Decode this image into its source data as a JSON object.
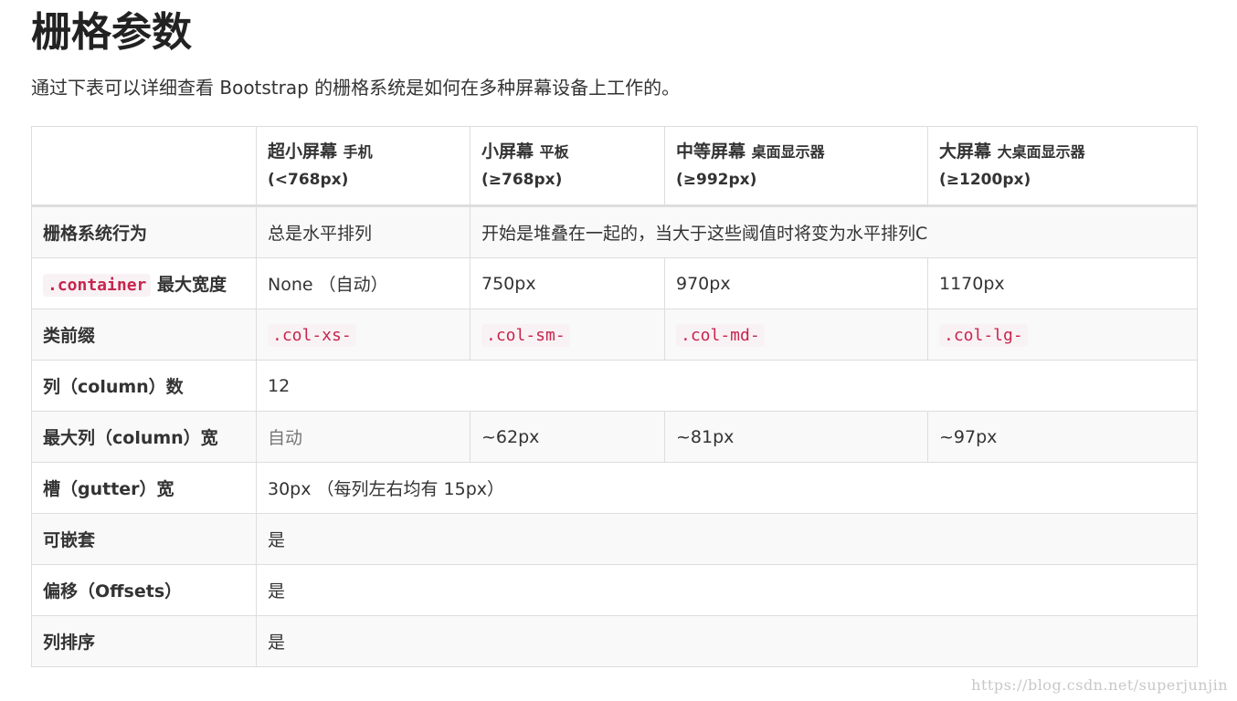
{
  "heading": "栅格参数",
  "intro": "通过下表可以详细查看 Bootstrap 的栅格系统是如何在多种屏幕设备上工作的。",
  "table": {
    "header": {
      "col1": {
        "main": "超小屏幕",
        "sub": "手机",
        "range": "(<768px)"
      },
      "col2": {
        "main": "小屏幕",
        "sub": "平板",
        "range": "(≥768px)"
      },
      "col3": {
        "main": "中等屏幕",
        "sub": "桌面显示器",
        "range": "(≥992px)"
      },
      "col4": {
        "main": "大屏幕",
        "sub": "大桌面显示器",
        "range": "(≥1200px)"
      }
    },
    "row_behavior": {
      "label": "栅格系统行为",
      "xs": "总是水平排列",
      "rest": "开始是堆叠在一起的，当大于这些阈值时将变为水平排列C"
    },
    "row_container": {
      "code": ".container",
      "label": "最大宽度",
      "xs": "None （自动）",
      "sm": "750px",
      "md": "970px",
      "lg": "1170px"
    },
    "row_prefix": {
      "label": "类前缀",
      "xs": ".col-xs-",
      "sm": ".col-sm-",
      "md": ".col-md-",
      "lg": ".col-lg-"
    },
    "row_columns": {
      "label": "列（column）数",
      "value": "12"
    },
    "row_colwidth": {
      "label": "最大列（column）宽",
      "xs": "自动",
      "sm": "~62px",
      "md": "~81px",
      "lg": "~97px"
    },
    "row_gutter": {
      "label": "槽（gutter）宽",
      "value": "30px （每列左右均有 15px）"
    },
    "row_nestable": {
      "label": "可嵌套",
      "value": "是"
    },
    "row_offsets": {
      "label": "偏移（Offsets）",
      "value": "是"
    },
    "row_ordering": {
      "label": "列排序",
      "value": "是"
    }
  },
  "watermark": "https://blog.csdn.net/superjunjin"
}
